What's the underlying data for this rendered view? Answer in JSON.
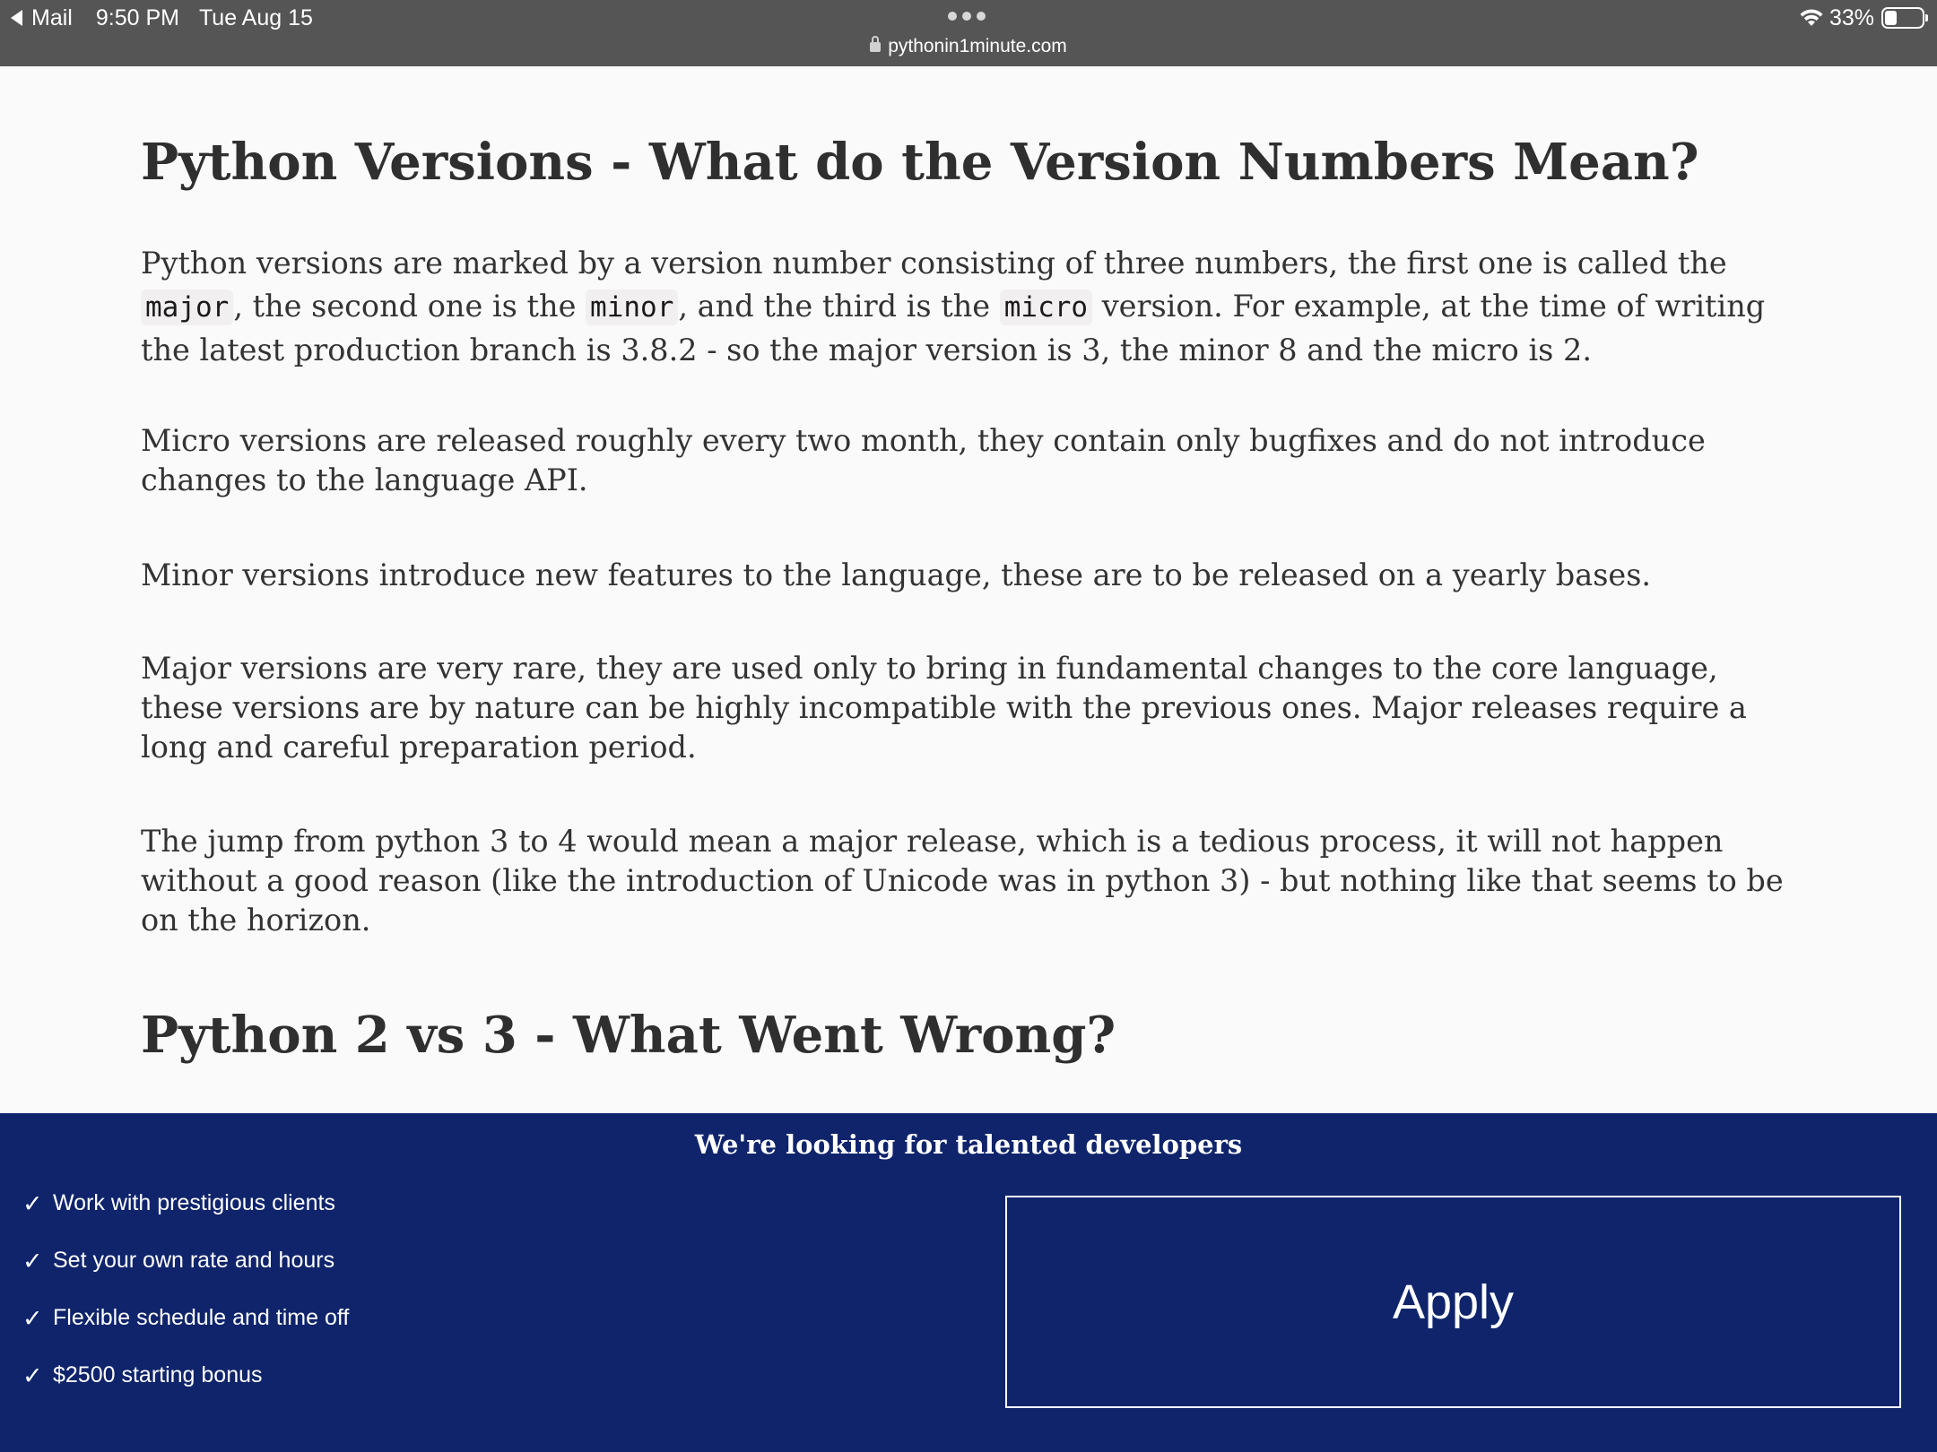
{
  "status_bar": {
    "back_app": "Mail",
    "time": "9:50 PM",
    "date": "Tue Aug 15",
    "battery": "33%",
    "battery_level": 0.33,
    "url": "pythonin1minute.com"
  },
  "article": {
    "heading1": "Python Versions - What do the Version Numbers Mean?",
    "p1": {
      "t1": "Python versions are marked by a version number consisting of three numbers, the first one is called the ",
      "c1": "major",
      "t2": ", the second one is the ",
      "c2": "minor",
      "t3": ", and the third is the ",
      "c3": "micro",
      "t4": " version. For example, at the time of writing the latest production branch is 3.8.2 - so the major version is 3, the minor 8 and the micro is 2."
    },
    "p2": "Micro versions are released roughly every two month, they contain only bugfixes and do not introduce changes to the language API.",
    "p3": "Minor versions introduce new features to the language, these are to be released on a yearly bases.",
    "p4": "Major versions are very rare, they are used only to bring in fundamental changes to the core language, these versions are by nature can be highly incompatible with the previous ones. Major releases require a long and careful preparation period.",
    "p5": "The jump from python 3 to 4 would mean a major release, which is a tedious process, it will not happen without a good reason (like the introduction of Unicode was in python 3) - but nothing like that seems to be on the horizon.",
    "heading2": "Python 2 vs 3 - What Went Wrong?"
  },
  "banner": {
    "title": "We're looking for talented developers",
    "check_mark": "✓",
    "benefits": [
      "Work with prestigious clients",
      "Set your own rate and hours",
      "Flexible schedule and time off",
      "$2500 starting bonus"
    ],
    "apply_label": "Apply",
    "background": "#0f246b"
  }
}
